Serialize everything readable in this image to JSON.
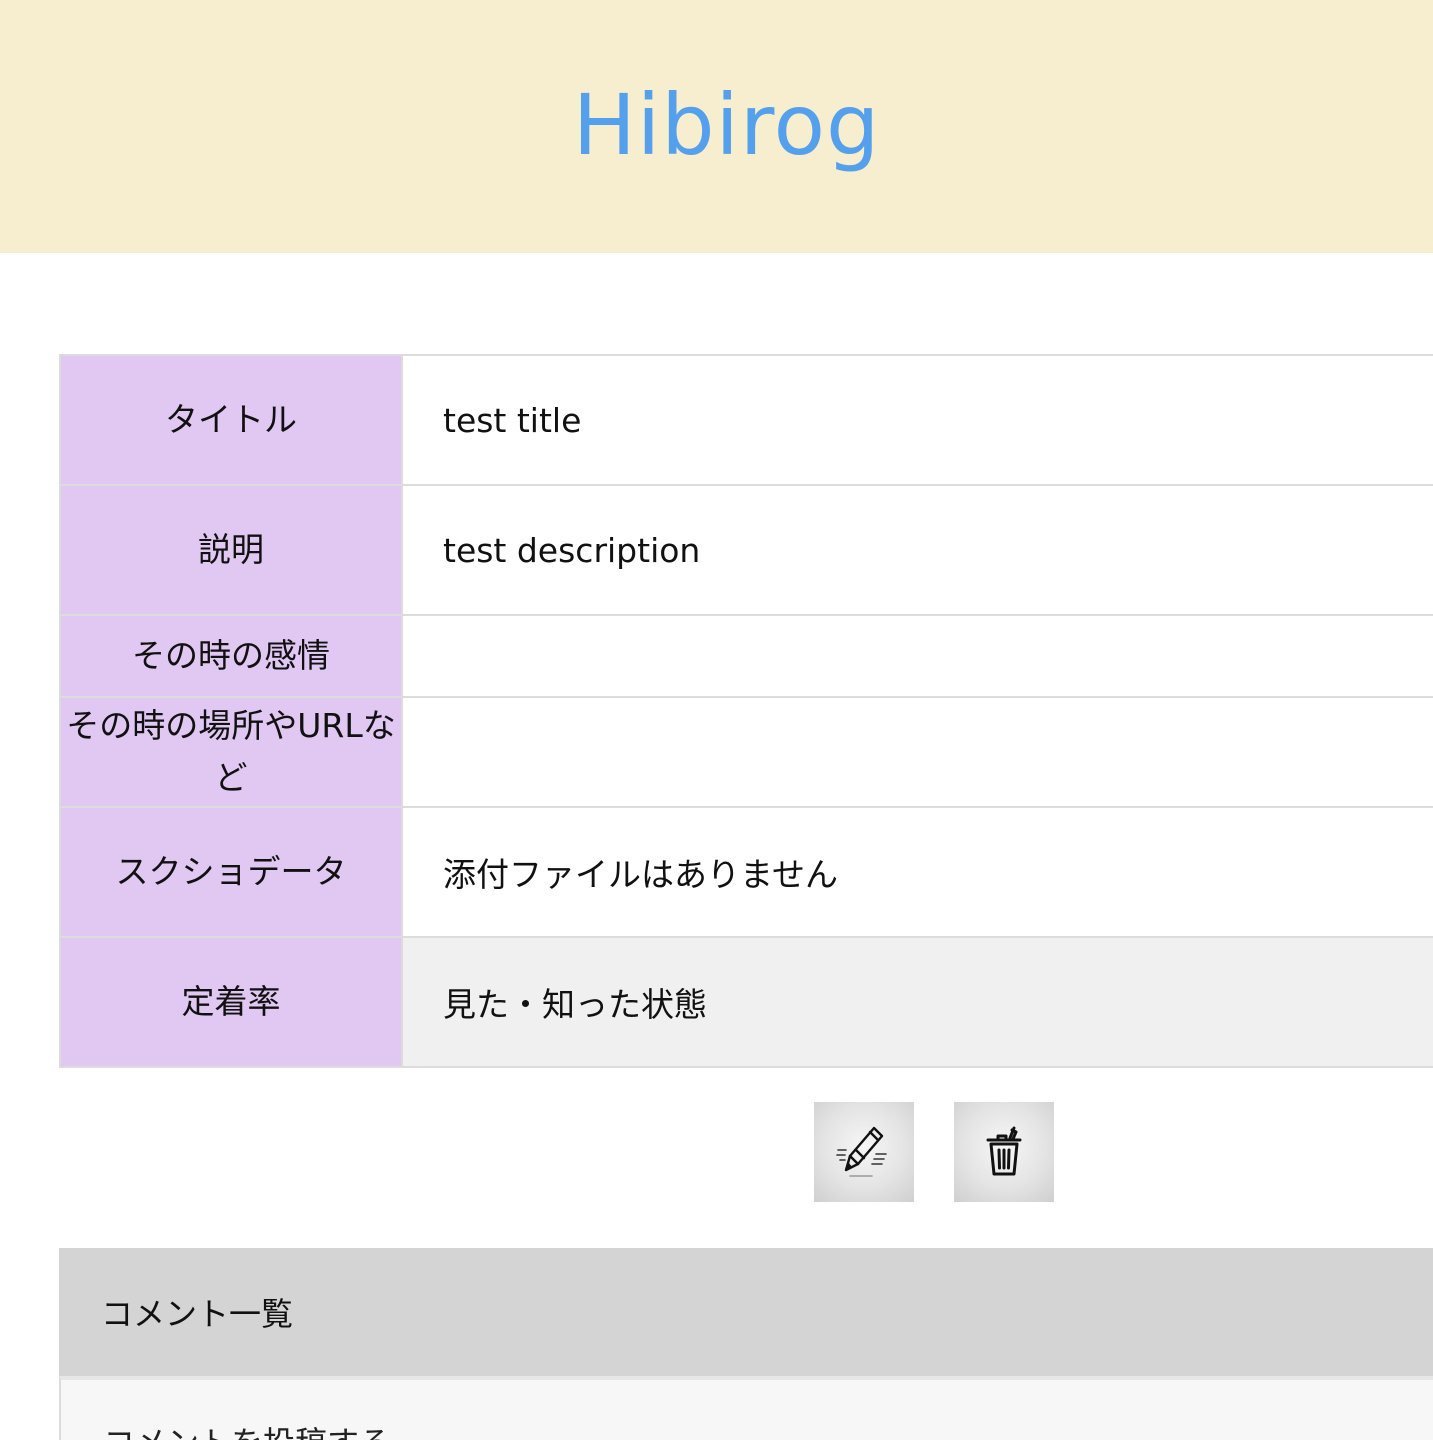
{
  "header": {
    "brand": "Hibirog",
    "background": "#f6eecf",
    "brand_color": "#55a0ec"
  },
  "detail": {
    "label_background": "#e0c8f2",
    "rows": [
      {
        "label": "タイトル",
        "value": "test title"
      },
      {
        "label": "説明",
        "value": "test description"
      },
      {
        "label": "その時の感情",
        "value": ""
      },
      {
        "label": "その時の場所やURLなど",
        "value": ""
      },
      {
        "label": "スクショデータ",
        "value": "添付ファイルはありません"
      },
      {
        "label": "定着率",
        "value": "見た・知った状態"
      }
    ]
  },
  "actions": {
    "edit_icon": "pencil-icon",
    "delete_icon": "trash-icon"
  },
  "comments": {
    "header": "コメント一覧",
    "post_label": "コメントを投稿する",
    "header_background": "#d4d4d4"
  }
}
